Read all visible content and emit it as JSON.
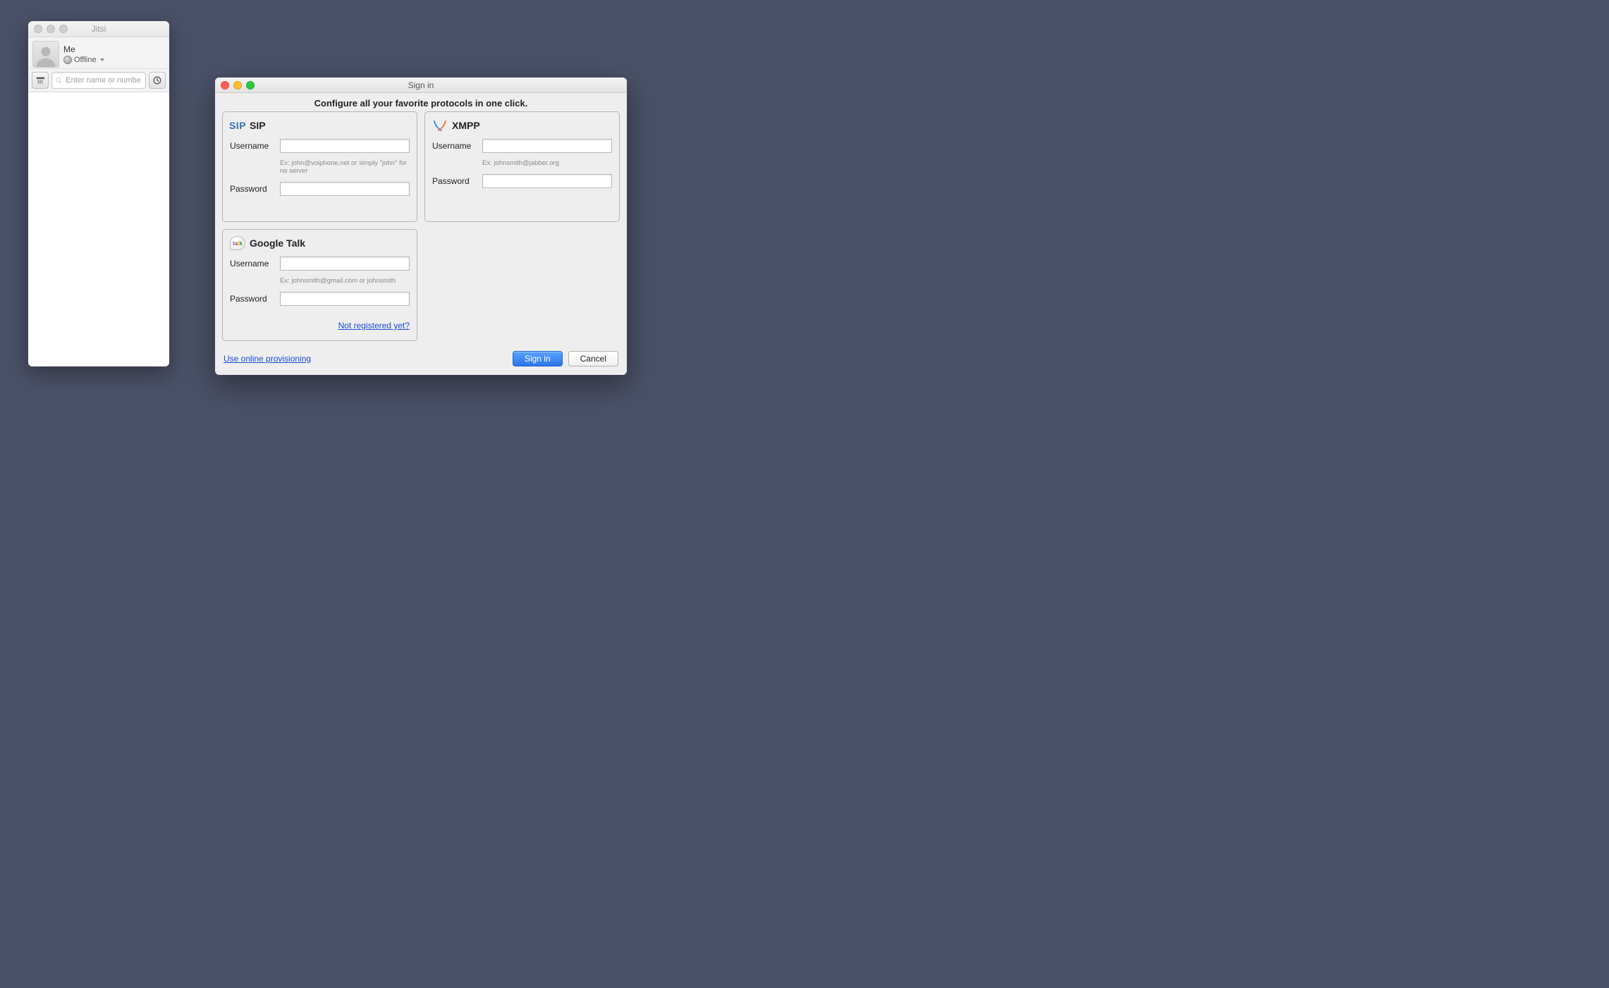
{
  "main": {
    "title": "Jitsi",
    "user_name": "Me",
    "status_label": "Offline",
    "search_placeholder": "Enter name or number"
  },
  "signin": {
    "title": "Sign in",
    "heading": "Configure all your favorite protocols in one click.",
    "provisioning_link": "Use online provisioning",
    "signin_button": "Sign in",
    "cancel_button": "Cancel",
    "sip": {
      "title": "SIP",
      "username_label": "Username",
      "username_value": "",
      "username_hint": "Ex: john@voiphone.net or simply \"john\" for no server",
      "password_label": "Password",
      "password_value": ""
    },
    "xmpp": {
      "title": "XMPP",
      "username_label": "Username",
      "username_value": "",
      "username_hint": "Ex: johnsmith@jabber.org",
      "password_label": "Password",
      "password_value": ""
    },
    "gtalk": {
      "title": "Google Talk",
      "username_label": "Username",
      "username_value": "",
      "username_hint": "Ex: johnsmith@gmail.com or johnsmith",
      "password_label": "Password",
      "password_value": "",
      "register_link": "Not registered yet?"
    }
  }
}
